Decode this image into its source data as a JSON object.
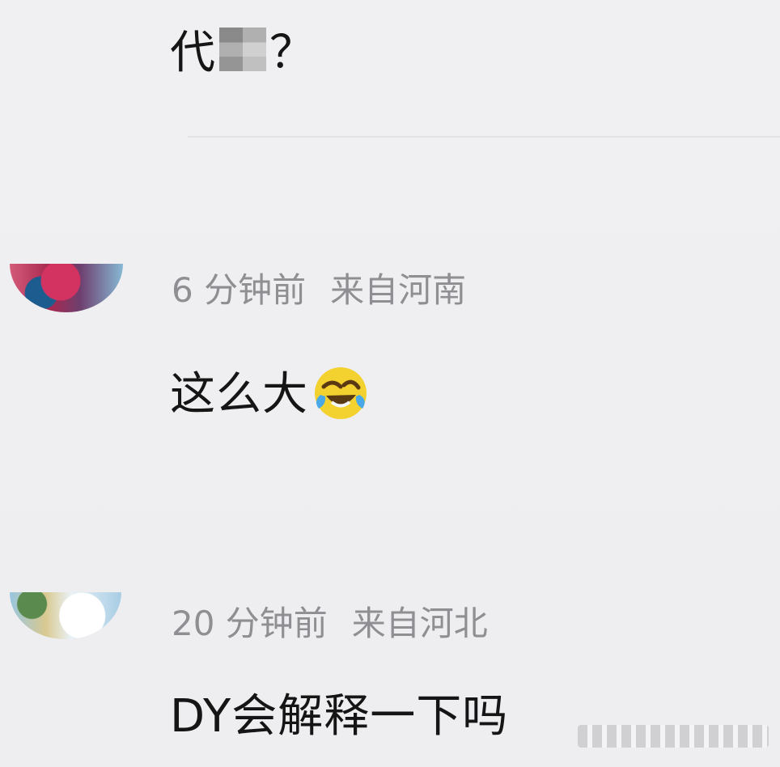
{
  "comments": [
    {
      "text": "代",
      "suffix": "？"
    },
    {
      "time": "6 分钟前",
      "location": "来自河南",
      "text": "这么大"
    },
    {
      "time": "20 分钟前",
      "location": "来自河北",
      "text": "DY会解释一下吗"
    }
  ],
  "colors": {
    "background": "#efeff1",
    "meta": "#8f8f93",
    "text": "#151515"
  },
  "icons": {
    "emoji": "laughing-crying-emoji-icon"
  }
}
